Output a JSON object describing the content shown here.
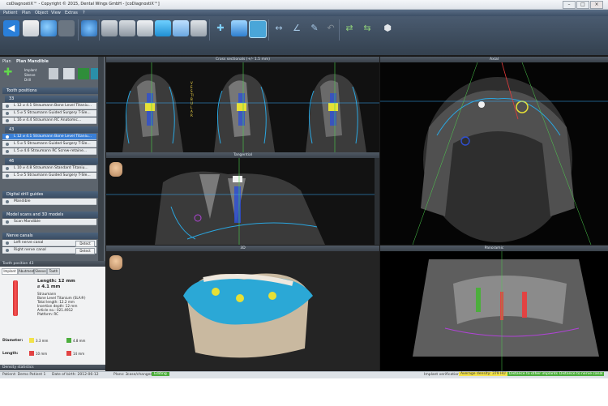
{
  "window": {
    "title": "coDiagnostiX™ - Copyright © 2015, Dental Wings GmbH - [coDiagnostiX™]"
  },
  "menu": [
    "Patient",
    "Plan",
    "Object",
    "View",
    "Extras",
    "?"
  ],
  "colors": {
    "menubar": "#3d4f66",
    "panel": "#5c646d",
    "selection": "#3a7fd6",
    "warning": "#f2e24a",
    "ok": "#4cae3c"
  },
  "plan_panel": {
    "label": "Plan",
    "plan_name": "Plan Mandible",
    "radio_options": [
      "Implant",
      "Sleeve",
      "Drill"
    ]
  },
  "tooth_positions": {
    "header": "Tooth positions",
    "groups": [
      {
        "label": "33",
        "rows": [
          {
            "text": "L 12 ⌀ 4.1  Straumann Bone Level Titaniu..."
          },
          {
            "text": "L 5  ⌀ 5   Straumann Guided Surgery T-Sle..."
          },
          {
            "text": "L 16 ⌀ 4.4  Straumann RC Anatomic..."
          }
        ]
      },
      {
        "label": "43",
        "rows": [
          {
            "text": "L 12 ⌀ 4.1  Straumann Bone Level Titaniu...",
            "selected": true
          },
          {
            "text": "L 5  ⌀ 5   Straumann Guided Surgery T-Sle..."
          },
          {
            "text": "L 5  ⌀ 4.6  Straumann RC Screw-retaine..."
          }
        ]
      },
      {
        "label": "46",
        "rows": [
          {
            "text": "L 10 ⌀ 4.8  Straumann Standard Titaniu..."
          },
          {
            "text": "L 5  ⌀ 5   Straumann Guided Surgery T-Sle..."
          }
        ]
      }
    ]
  },
  "digital_drill": {
    "header": "Digital drill guides",
    "item": "Mandible"
  },
  "models": {
    "header": "Model scans and 3D models",
    "item": "Scan Mandible"
  },
  "nerves": {
    "header": "Nerve canals",
    "items": [
      {
        "label": "Left nerve canal",
        "button": "Detect"
      },
      {
        "label": "Right nerve canal",
        "button": "Detect"
      }
    ]
  },
  "info": {
    "title": "Tooth position 43",
    "tabs": [
      "Implant",
      "Abutment",
      "Sleeve",
      "Tooth"
    ],
    "heading1": "Length: 12 mm",
    "heading2": "⌀ 4.1 mm",
    "lines": [
      "Straumann",
      "Bone Level Titanium (SLA®)",
      "Total length: 12.2 mm",
      "Insertion depth: 12 mm",
      "Article no.: 021.4912",
      "Platform: RC"
    ],
    "diameter_label": "Diameter:",
    "length_label": "Length:",
    "diameter_vals": [
      "3.3 mm",
      "4.8 mm"
    ],
    "length_vals": [
      "10 mm",
      "14 mm"
    ],
    "density": "Density statistics"
  },
  "viewports": {
    "cross": "Cross sectionals (+/- 1.5 mm)",
    "axial": "Axial",
    "tangential": "Tangential",
    "v3d": "3D",
    "panoramic": "Panoramic",
    "side_label": "VESTIBULAR"
  },
  "status": {
    "patient": "Patient:  Demo Patient 1",
    "dob": "Date of birth:  2012-06-12",
    "plans": "Plans:  2",
    "case": "case/changes",
    "editing": "Editing",
    "verifications": "Implant verifications",
    "density": "Average density: 379 HU",
    "dist_implants": "Distance to other implants",
    "dist_nerve": "Distance to nerve canal"
  }
}
